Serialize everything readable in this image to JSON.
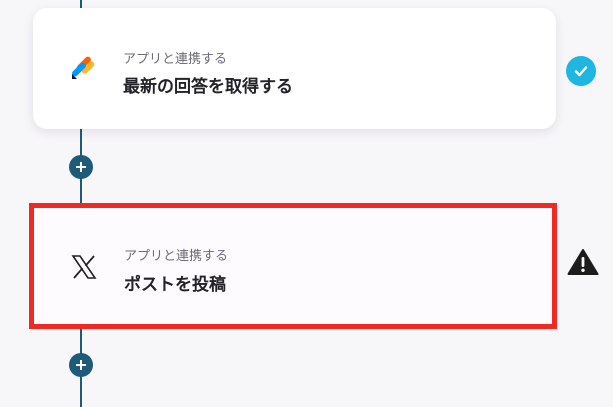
{
  "steps": [
    {
      "caption": "アプリと連携する",
      "title": "最新の回答を取得する",
      "app_icon": "jotform-logo-icon",
      "status": "check-icon",
      "status_color": "#1fb7e2"
    },
    {
      "caption": "アプリと連携する",
      "title": "ポストを投稿",
      "app_icon": "x-logo-icon",
      "status": "warning-icon",
      "highlight_color": "#ee2a23"
    }
  ],
  "colors": {
    "connector": "#1e5a75",
    "background": "#f7f6f9"
  }
}
